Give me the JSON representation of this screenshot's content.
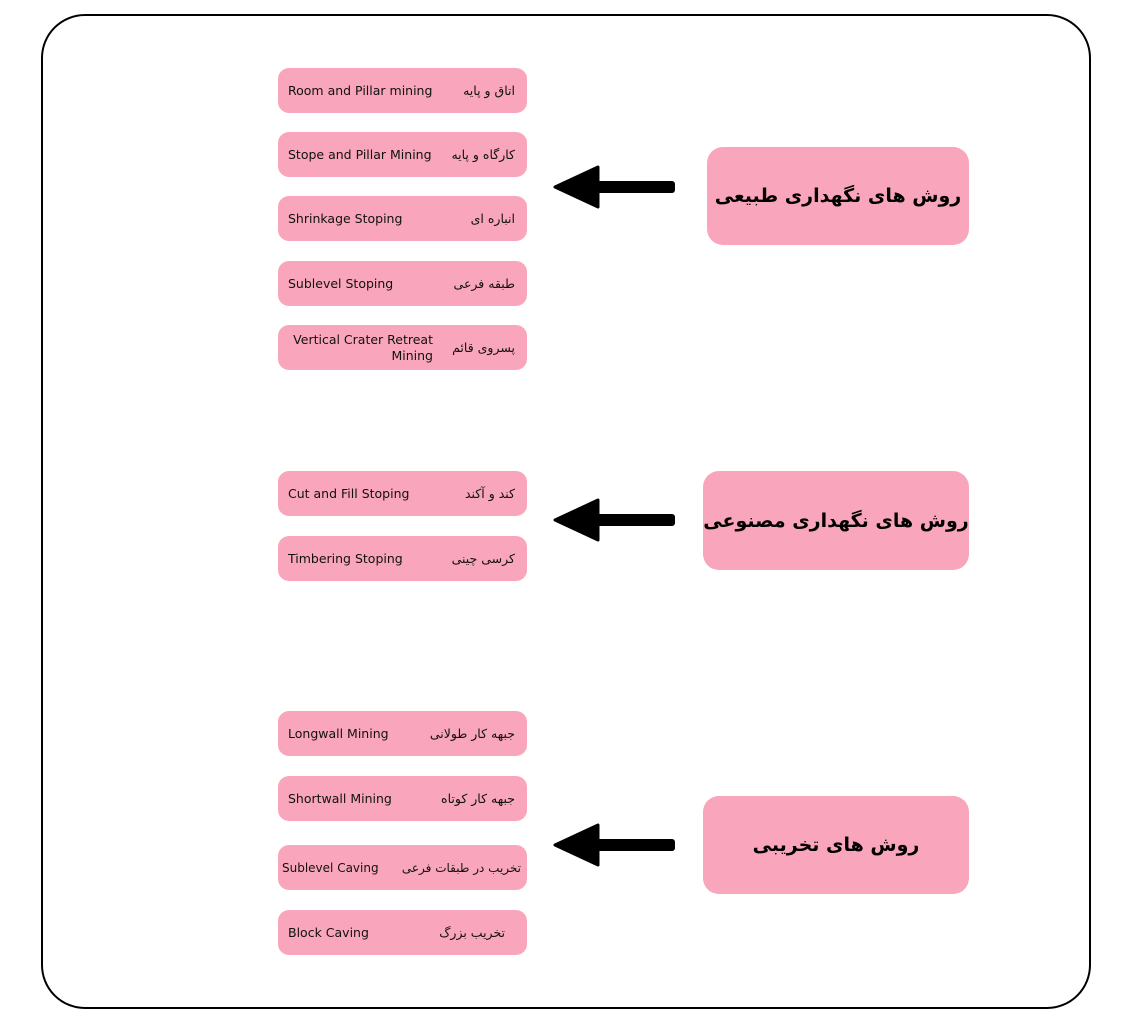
{
  "groups": [
    {
      "title": "روش های نگهداری طبیعی",
      "items": [
        {
          "en": "Room and Pillar mining",
          "fa": "اتاق و پایه"
        },
        {
          "en": "Stope and Pillar Mining",
          "fa": "کارگاه و پایه"
        },
        {
          "en": "Shrinkage Stoping",
          "fa": "انباره ای"
        },
        {
          "en": "Sublevel Stoping",
          "fa": "طبقه فرعی"
        },
        {
          "en": "Vertical Crater Retreat Mining",
          "fa": "پسروی قائم"
        }
      ]
    },
    {
      "title": "روش های نگهداری مصنوعی",
      "items": [
        {
          "en": "Cut and Fill Stoping",
          "fa": "کند و آکند"
        },
        {
          "en": "Timbering Stoping",
          "fa": "کرسی چینی"
        }
      ]
    },
    {
      "title": "روش های تخریبی",
      "items": [
        {
          "en": "Longwall Mining",
          "fa": "جبهه کار طولانی"
        },
        {
          "en": "Shortwall Mining",
          "fa": "جبهه کار کوتاه"
        },
        {
          "en": "Sublevel Caving",
          "fa": "تخریب در طبقات فرعی"
        },
        {
          "en": "Block Caving",
          "fa": "تخریب بزرگ"
        }
      ]
    }
  ],
  "colors": {
    "box": "#f9a5bb",
    "arrow": "#000000"
  }
}
